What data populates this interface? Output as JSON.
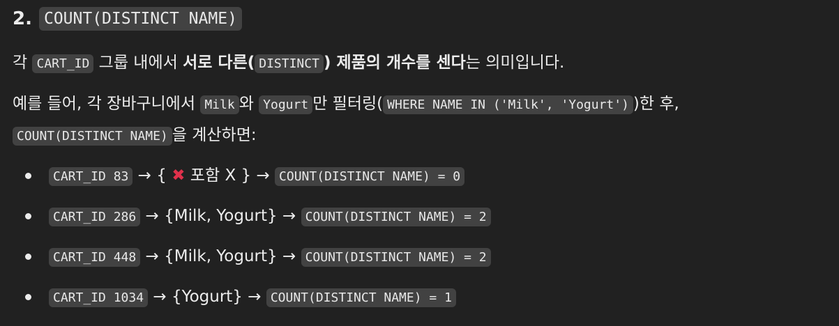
{
  "heading": {
    "number": "2.",
    "code": "COUNT(DISTINCT NAME)"
  },
  "paragraph1": {
    "pre": "각 ",
    "code1": "CART_ID",
    "mid": " 그룹 내에서 ",
    "bold1": "서로 다른(",
    "code2": "DISTINCT",
    "bold2": ") 제품의 개수를 센다",
    "post": "는 의미입니다."
  },
  "paragraph2": {
    "pre": "예를 들어, 각 장바구니에서 ",
    "code1": "Milk",
    "mid1": "와 ",
    "code2": "Yogurt",
    "mid2": "만 필터링(",
    "code3": "WHERE NAME IN ('Milk', 'Yogurt')",
    "post": ")한 후,",
    "code4": "COUNT(DISTINCT NAME)",
    "post2": "을 계산하면:"
  },
  "items": [
    {
      "cart": "CART_ID 83",
      "arrow1": " → { ",
      "cross": "✖",
      "detail": " 포함 X } → ",
      "result": "COUNT(DISTINCT NAME) = 0"
    },
    {
      "cart": "CART_ID 286",
      "arrow1": " → {Milk, Yogurt} → ",
      "result": "COUNT(DISTINCT NAME) = 2"
    },
    {
      "cart": "CART_ID 448",
      "arrow1": " → {Milk, Yogurt} → ",
      "result": "COUNT(DISTINCT NAME) = 2"
    },
    {
      "cart": "CART_ID 1034",
      "arrow1": " → {Yogurt} → ",
      "result": "COUNT(DISTINCT NAME) = 1"
    }
  ]
}
